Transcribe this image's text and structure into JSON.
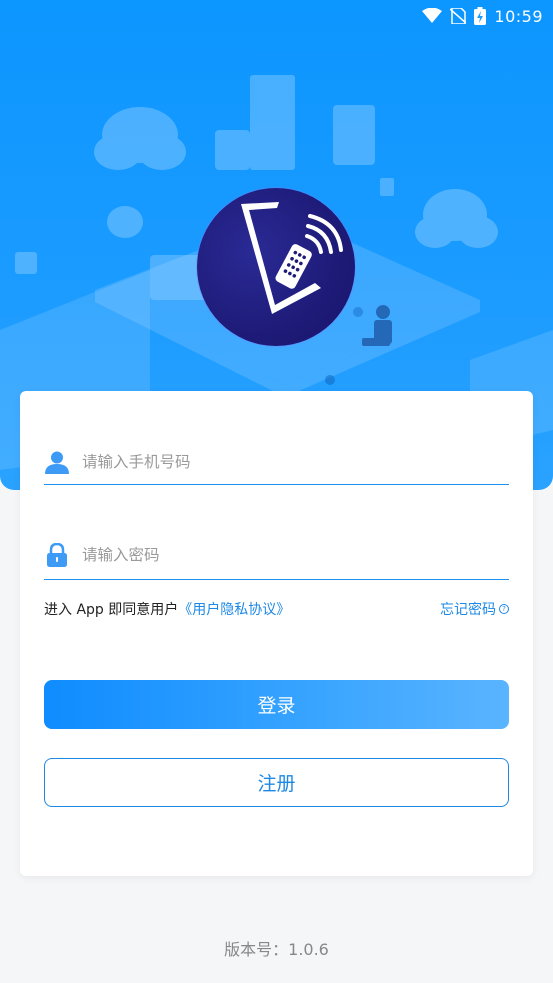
{
  "status_bar": {
    "time": "10:59",
    "icons": [
      "wifi-icon",
      "no-sim-icon",
      "battery-charging-icon"
    ]
  },
  "colors": {
    "primary": "#1e88e5",
    "hero_bg": "#1a9bff",
    "logo_bg": "#1e1b78"
  },
  "logo": {
    "icon": "remote-control-logo-icon"
  },
  "login_form": {
    "phone": {
      "placeholder": "请输入手机号码",
      "value": "",
      "icon": "user-icon"
    },
    "password": {
      "placeholder": "请输入密码",
      "value": "",
      "icon": "lock-icon"
    },
    "agreement_prefix": "进入 App 即同意用户",
    "agreement_link": "《用户隐私协议》",
    "forgot_password": "忘记密码",
    "login_button": "登录",
    "register_button": "注册"
  },
  "footer": {
    "version_text": "版本号：1.0.6"
  }
}
